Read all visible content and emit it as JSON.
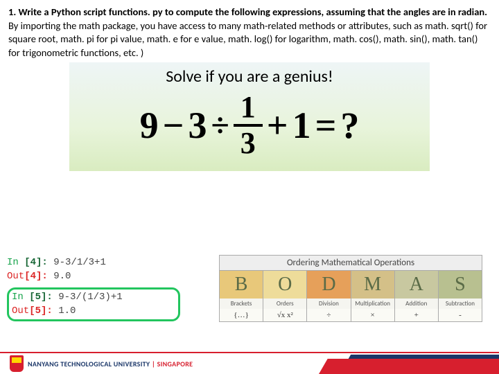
{
  "question": {
    "bold1": "1. Write a Python script functions. py to compute the following expressions, assuming that the angles are in radian.",
    "rest": " By importing the math package, you have access to many math-related methods or attributes, such as math. sqrt() for square root, math. pi for pi value, math. e for e value, math. log() for logarithm, math. cos(), math. sin(), math. tan() for trigonometric functions, etc. )"
  },
  "genius": {
    "title": "Solve if you are a genius!",
    "eq": {
      "a": "9",
      "op1": "−",
      "b": "3",
      "div": "÷",
      "num": "1",
      "den": "3",
      "op2": "+",
      "c": "1",
      "eq": "=",
      "q": "?"
    }
  },
  "code": {
    "l1": {
      "in": "In ",
      "n": "[4]:",
      "t": " 9-3/1/3+1"
    },
    "l2": {
      "out": "Out",
      "n": "[4]:",
      "t": " 9.0"
    },
    "l3": {
      "in": "In ",
      "n": "[5]:",
      "t": " 9-3/(1/3)+1"
    },
    "l4": {
      "out": "Out",
      "n": "[5]:",
      "t": " 1.0"
    }
  },
  "bodmas": {
    "title": "Ordering Mathematical Operations",
    "letters": [
      "B",
      "O",
      "D",
      "M",
      "A",
      "S"
    ],
    "words": [
      "Brackets",
      "Orders",
      "Division",
      "Multiplication",
      "Addition",
      "Subtraction"
    ],
    "syms": [
      "{…}",
      "√x  x²",
      "÷",
      "×",
      "+",
      "-"
    ]
  },
  "footer": {
    "uni": "NANYANG TECHNOLOGICAL UNIVERSITY",
    "sg": "SINGAPORE"
  }
}
